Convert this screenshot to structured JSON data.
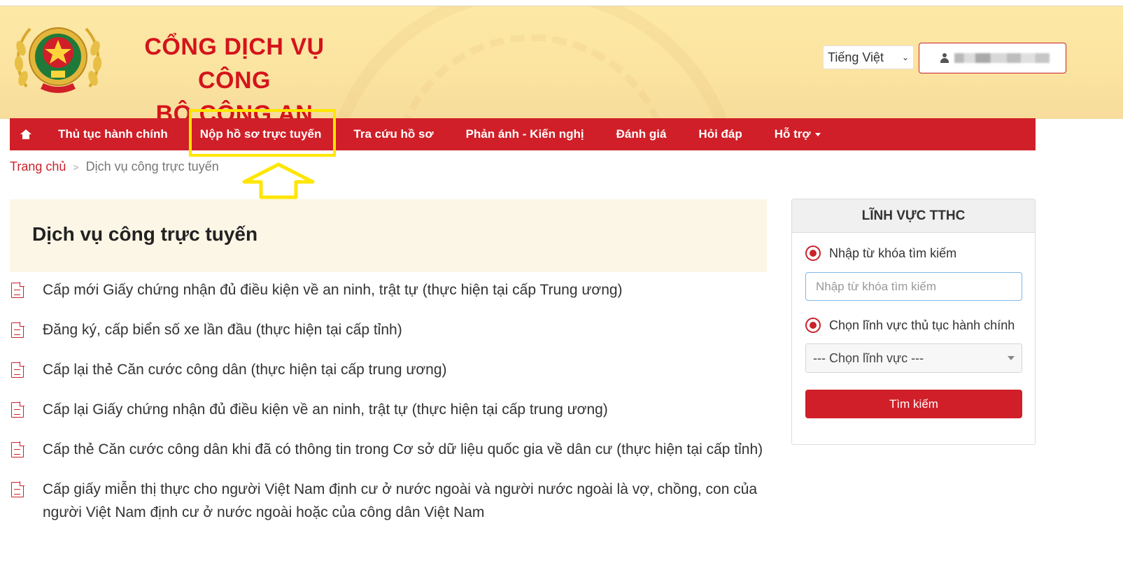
{
  "header": {
    "title_line1": "CỔNG DỊCH VỤ CÔNG",
    "title_line2": "BỘ CÔNG AN",
    "language": "Tiếng Việt",
    "brand_color": "#d01f28",
    "emblem_icon": "police-emblem-icon",
    "user_icon": "user-icon"
  },
  "nav": {
    "home_icon": "home-icon",
    "items": [
      {
        "label": "Thủ tục hành chính"
      },
      {
        "label": "Nộp hồ sơ trực tuyến"
      },
      {
        "label": "Tra cứu hồ sơ"
      },
      {
        "label": "Phản ánh - Kiến nghị"
      },
      {
        "label": "Đánh giá"
      },
      {
        "label": "Hỏi đáp"
      },
      {
        "label": "Hỗ trợ"
      }
    ],
    "highlight_color": "#ffe600"
  },
  "breadcrumb": {
    "home": "Trang chủ",
    "separator": ">",
    "current": "Dịch vụ công trực tuyến"
  },
  "main": {
    "heading": "Dịch vụ công trực tuyến",
    "services": [
      "Cấp mới Giấy chứng nhận đủ điều kiện về an ninh, trật tự (thực hiện tại cấp Trung ương)",
      "Đăng ký, cấp biển số xe lần đầu (thực hiện tại cấp tỉnh)",
      "Cấp lại thẻ Căn cước công dân (thực hiện tại cấp trung ương)",
      "Cấp lại Giấy chứng nhận đủ điều kiện về an ninh, trật tự (thực hiện tại cấp trung ương)",
      "Cấp thẻ Căn cước công dân khi đã có thông tin trong Cơ sở dữ liệu quốc gia về dân cư (thực hiện tại cấp tỉnh)",
      "Cấp giấy miễn thị thực cho người Việt Nam định cư ở nước ngoài và người nước ngoài là vợ, chồng, con của người Việt Nam định cư ở nước ngoài hoặc của công dân Việt Nam"
    ]
  },
  "sidebar": {
    "title": "LĨNH VỰC TTHC",
    "keyword_option": "Nhập từ khóa tìm kiếm",
    "keyword_placeholder": "Nhập từ khóa tìm kiếm",
    "field_option": "Chọn lĩnh vực thủ tục hành chính",
    "field_select": "--- Chọn lĩnh vực ---",
    "search_button": "Tìm kiếm"
  }
}
